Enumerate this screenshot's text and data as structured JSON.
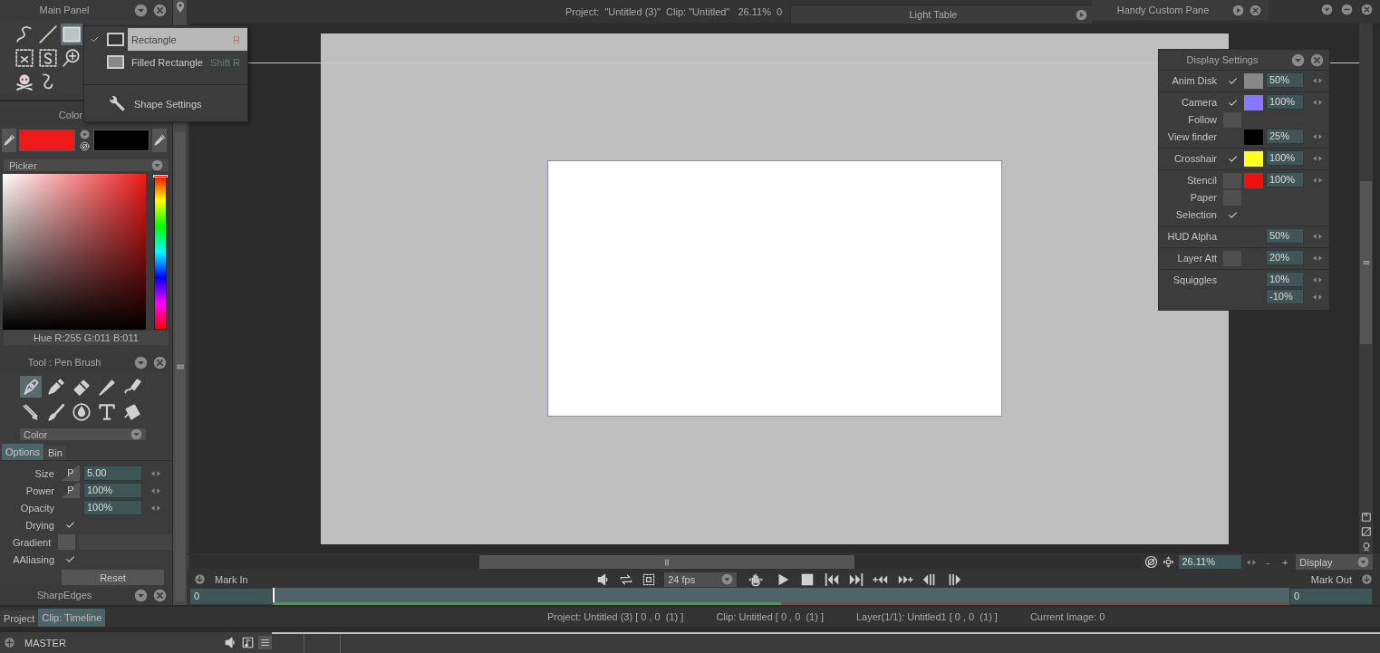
{
  "main_panel": {
    "title": "Main Panel",
    "tools": [
      {
        "kind": "curve",
        "selected": false
      },
      {
        "kind": "line",
        "selected": false
      },
      {
        "kind": "rect",
        "selected": true
      },
      {
        "kind": "lasso",
        "selected": false
      },
      {
        "kind": "sselect",
        "selected": false
      },
      {
        "kind": "zoom",
        "selected": false
      },
      {
        "kind": "skull",
        "selected": false
      },
      {
        "kind": "hook",
        "selected": false
      }
    ]
  },
  "color_panel": {
    "title": "Color",
    "swatches": [
      {
        "color": "#ee1a1a"
      },
      {
        "color": "#000000"
      }
    ],
    "picker_label": "Picker",
    "hue_slider": {
      "level": 0
    },
    "readout": "Hue R:255 G:011 B:011"
  },
  "tool_panel": {
    "title": "Tool : Pen Brush",
    "tools": [
      {
        "kind": "pen",
        "selected": true
      },
      {
        "kind": "pencil",
        "selected": false
      },
      {
        "kind": "eraser",
        "selected": false
      },
      {
        "kind": "marker",
        "selected": false
      },
      {
        "kind": "tube",
        "selected": false
      },
      {
        "kind": "cutter",
        "selected": false
      },
      {
        "kind": "brush",
        "selected": false
      },
      {
        "kind": "drop",
        "selected": false
      },
      {
        "kind": "type",
        "selected": false
      },
      {
        "kind": "bucket",
        "selected": false
      }
    ],
    "mode": "Color",
    "tabs": [
      {
        "label": "Options",
        "selected": true
      },
      {
        "label": "Bin",
        "selected": false
      }
    ],
    "options": [
      {
        "kind": "number",
        "label": "Size",
        "pressure": "P",
        "value": "5.00"
      },
      {
        "kind": "number",
        "label": "Power",
        "pressure": "P",
        "value": "100%"
      },
      {
        "kind": "number",
        "label": "Opacity",
        "value": "100%"
      },
      {
        "kind": "check",
        "label": "Drying",
        "checked": true
      },
      {
        "kind": "gradient",
        "label": "Gradient"
      },
      {
        "kind": "check",
        "label": "AAliasing",
        "checked": true
      }
    ],
    "reset": "Reset"
  },
  "next_panel": {
    "title": "SharpEdges"
  },
  "top_bar": {
    "info": "Project:  \"Untitled (3)\"  Clip: \"Untitled\"   26.11%  0"
  },
  "light_table": {
    "title": "Light Table"
  },
  "handy_pane": {
    "title": "Handy Custom Pane"
  },
  "shape_menu": {
    "items": [
      {
        "kind": "outline-shape",
        "label": "Rectangle",
        "shortcut": "R",
        "checked": true,
        "selected": true
      },
      {
        "kind": "filled-shape",
        "label": "Filled Rectangle",
        "shortcut": "Shift R",
        "checked": false,
        "selected": false
      },
      {
        "kind": "settings",
        "label": "Shape Settings"
      }
    ]
  },
  "display_settings": {
    "title": "Display Settings",
    "groups": [
      [
        {
          "label": "Anim Disk",
          "checked": true,
          "color": "#888888",
          "values": [
            "50%"
          ]
        }
      ],
      [
        {
          "label": "Camera",
          "checked": true,
          "color": "#8877ff",
          "values": [
            "100%"
          ]
        },
        {
          "label": "Follow",
          "checked": false
        },
        {
          "label": "View finder",
          "color": "#000000",
          "values": [
            "25%"
          ]
        }
      ],
      [
        {
          "label": "Crosshair",
          "checked": true,
          "color": "#ffff22",
          "values": [
            "100%"
          ]
        }
      ],
      [
        {
          "label": "Stencil",
          "checked": false,
          "color": "#ee1111",
          "values": [
            "100%"
          ]
        },
        {
          "label": "Paper",
          "checked": false
        },
        {
          "label": "Selection",
          "checked": true
        }
      ],
      [
        {
          "label": "HUD Alpha",
          "values": [
            "50%"
          ]
        }
      ],
      [
        {
          "label": "Layer Att",
          "checked": false,
          "values": [
            "20%"
          ]
        }
      ],
      [
        {
          "label": "Squiggles",
          "values": [
            "10%",
            "-10%"
          ]
        }
      ]
    ]
  },
  "viewer": {
    "zoom": "26.11%",
    "minus": "-",
    "plus": "+",
    "display": "Display",
    "mark_in": "Mark In",
    "fps": "24 fps",
    "mark_out": "Mark Out",
    "in_frame": "0",
    "out_frame": "0",
    "cache": {
      "level": 0.5
    }
  },
  "bottom_tabs": [
    {
      "label": "Project",
      "selected": false
    },
    {
      "label": "Clip: Timeline",
      "selected": true
    }
  ],
  "status": [
    "Project: Untitled (3) [ 0 , 0  (1) ]",
    "Clip: Untitled [ 0 , 0  (1) ]",
    "Layer(1/1): Untitled1 [ 0 , 0  (1) ]",
    "Current Image: 0"
  ],
  "track": {
    "name": "MASTER"
  }
}
